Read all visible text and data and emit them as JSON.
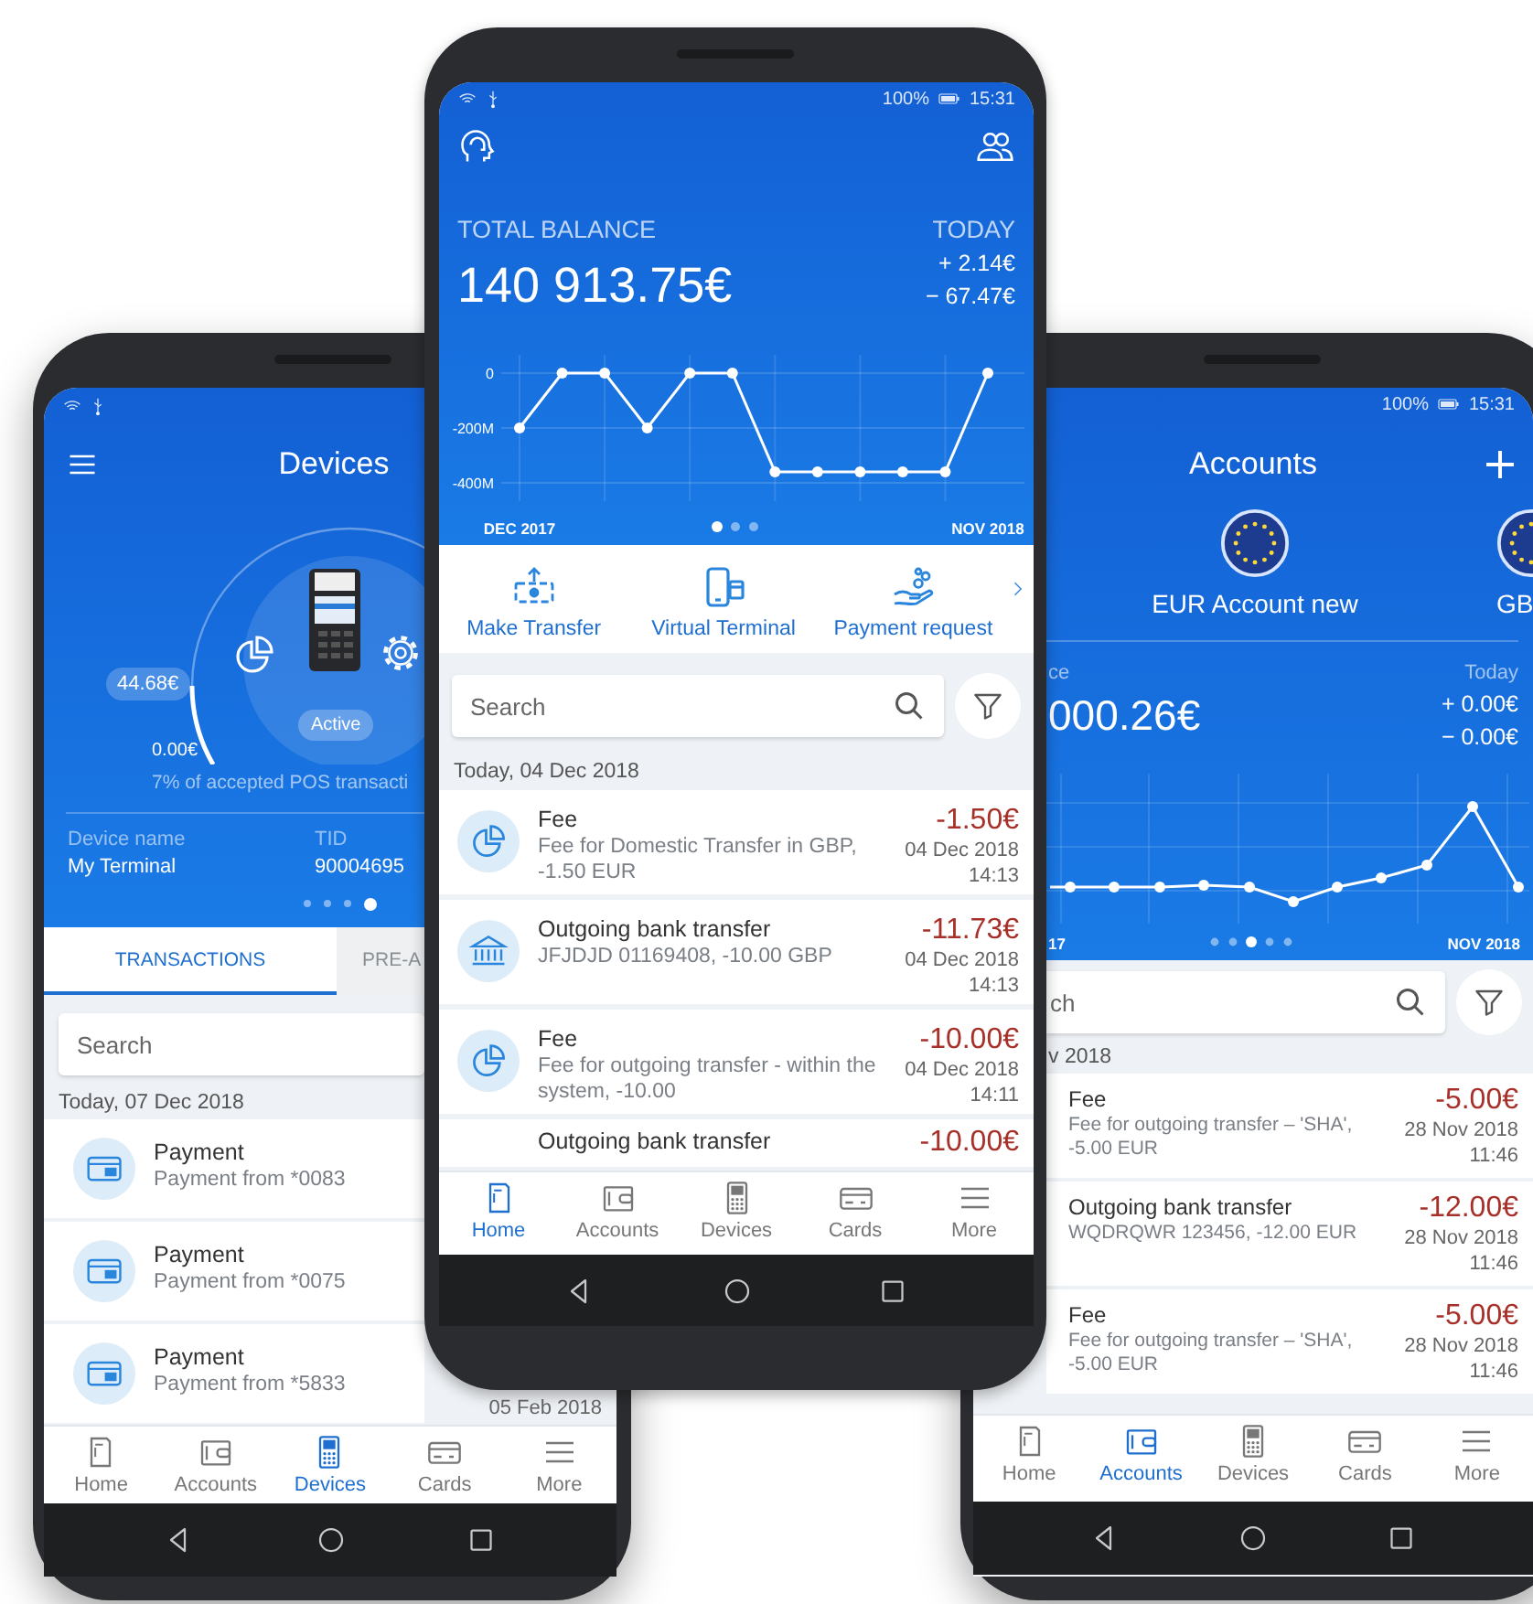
{
  "devices_screen": {
    "title": "Devices",
    "gauge": {
      "amount": "44.68€",
      "minimum": "0.00€",
      "status": "Active"
    },
    "caption": "7% of accepted POS transacti",
    "details": [
      {
        "label": "Device name",
        "value": "My Terminal"
      },
      {
        "label": "TID",
        "value": "90004695"
      }
    ],
    "pager": [
      {
        "selected": false
      },
      {
        "selected": false
      },
      {
        "selected": false
      },
      {
        "selected": true
      }
    ],
    "tabs": [
      {
        "label": "TRANSACTIONS",
        "selected": true
      },
      {
        "label": "PRE-A",
        "selected": false
      }
    ],
    "search": {
      "placeholder": "Search"
    },
    "date_header": "Today, 07 Dec 2018",
    "transactions": [
      {
        "kind": "card",
        "title": "Payment",
        "description": "Payment from *0083"
      },
      {
        "kind": "card",
        "title": "Payment",
        "description": "Payment from *0075"
      },
      {
        "kind": "card",
        "title": "Payment",
        "description": "Payment from *5833",
        "date": "05 Feb 2018"
      }
    ],
    "nav": [
      {
        "label": "Home",
        "kind": "pos",
        "selected": false
      },
      {
        "label": "Accounts",
        "kind": "wallet",
        "selected": false
      },
      {
        "label": "Devices",
        "kind": "device",
        "selected": true
      },
      {
        "label": "Cards",
        "kind": "cards",
        "selected": false
      },
      {
        "label": "More",
        "kind": "more",
        "selected": false
      }
    ]
  },
  "home_screen": {
    "status_bar": {
      "battery": "100%",
      "time": "15:31"
    },
    "balance": {
      "label": "TOTAL BALANCE",
      "amount": "140 913.75€"
    },
    "today": {
      "label": "TODAY",
      "income": "+ 2.14€",
      "expense": "− 67.47€"
    },
    "chart": {
      "chart_data": {
        "type": "line",
        "categories": [
          "DEC 2017",
          null,
          null,
          null,
          null,
          null,
          null,
          null,
          null,
          null,
          null,
          "NOV 2018"
        ],
        "series": [
          {
            "color": "#ffffff",
            "marker": true,
            "values": [
              -200,
              0,
              0,
              -200,
              0,
              0,
              -360,
              -360,
              -360,
              -360,
              -360,
              0
            ]
          }
        ],
        "grid": true,
        "ylim": [
          -400,
          0
        ],
        "yticks": [
          {
            "value": 0,
            "label": "0"
          },
          {
            "value": -200,
            "label": "-200M"
          },
          {
            "value": -400,
            "label": "-400M"
          }
        ]
      }
    },
    "pager": [
      {
        "selected": true
      },
      {
        "selected": false
      },
      {
        "selected": false
      }
    ],
    "quick_actions": [
      {
        "label": "Make Transfer",
        "kind": "transfer"
      },
      {
        "label": "Virtual Terminal",
        "kind": "terminal"
      },
      {
        "label": "Payment request",
        "kind": "request"
      }
    ],
    "search": {
      "placeholder": "Search"
    },
    "date_header": "Today, 04 Dec 2018",
    "transactions": [
      {
        "kind": "fee",
        "title": "Fee",
        "description": "Fee for Domestic Transfer in GBP, -1.50 EUR",
        "amount": "-1.50€",
        "date": "04 Dec 2018",
        "time": "14:13"
      },
      {
        "kind": "bank",
        "title": "Outgoing bank transfer",
        "description": "JFJDJD 01169408, -10.00 GBP",
        "amount": "-11.73€",
        "date": "04 Dec 2018",
        "time": "14:13"
      },
      {
        "kind": "fee",
        "title": "Fee",
        "description": "Fee for outgoing transfer - within the system, -10.00",
        "amount": "-10.00€",
        "date": "04 Dec 2018",
        "time": "14:11"
      },
      {
        "title": "Outgoing bank transfer",
        "amount": "-10.00€"
      }
    ],
    "nav": [
      {
        "label": "Home",
        "kind": "pos",
        "selected": true
      },
      {
        "label": "Accounts",
        "kind": "wallet",
        "selected": false
      },
      {
        "label": "Devices",
        "kind": "device",
        "selected": false
      },
      {
        "label": "Cards",
        "kind": "cards",
        "selected": false
      },
      {
        "label": "More",
        "kind": "more",
        "selected": false
      }
    ]
  },
  "accounts_screen": {
    "status_bar": {
      "battery": "100%",
      "time": "15:31"
    },
    "title": "Accounts",
    "accounts": [
      {
        "name": "EUR Account new"
      },
      {
        "name": "GB"
      }
    ],
    "balance": {
      "label": "ce",
      "amount": "000.26€"
    },
    "today": {
      "label": "Today",
      "income": "+ 0.00€",
      "expense": "− 0.00€"
    },
    "chart_labels": {
      "start": "17",
      "end": "NOV 2018"
    },
    "pager": [
      {
        "selected": false
      },
      {
        "selected": false
      },
      {
        "selected": true
      },
      {
        "selected": false
      },
      {
        "selected": false
      }
    ],
    "search": {
      "placeholder": "ch"
    },
    "date_header": "v 2018",
    "transactions": [
      {
        "title": "Fee",
        "description": "Fee for outgoing transfer – 'SHA', -5.00 EUR",
        "amount": "-5.00€",
        "date": "28 Nov 2018",
        "time": "11:46"
      },
      {
        "title": "Outgoing bank transfer",
        "description": "WQDRQWR 123456, -12.00 EUR",
        "amount": "-12.00€",
        "date": "28 Nov 2018",
        "time": "11:46"
      },
      {
        "title": "Fee",
        "description": "Fee for outgoing transfer – 'SHA', -5.00 EUR",
        "amount": "-5.00€",
        "date": "28 Nov 2018",
        "time": "11:46"
      }
    ],
    "nav": [
      {
        "label": "Home",
        "kind": "pos",
        "selected": false
      },
      {
        "label": "Accounts",
        "kind": "wallet",
        "selected": true
      },
      {
        "label": "Devices",
        "kind": "device",
        "selected": false
      },
      {
        "label": "Cards",
        "kind": "cards",
        "selected": false
      },
      {
        "label": "More",
        "kind": "more",
        "selected": false
      }
    ]
  }
}
